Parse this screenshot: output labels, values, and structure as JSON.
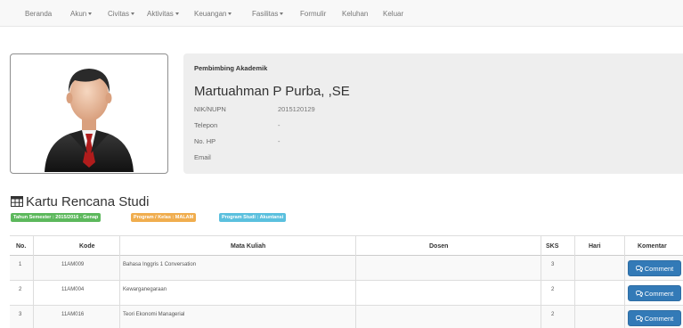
{
  "nav": {
    "items": [
      {
        "label": "Beranda",
        "dropdown": false
      },
      {
        "label": "Akun",
        "dropdown": true
      },
      {
        "label": "Civitas",
        "dropdown": true
      },
      {
        "label": "Aktivitas",
        "dropdown": true
      },
      {
        "label": "Keuangan",
        "dropdown": true
      },
      {
        "label": "Fasilitas",
        "dropdown": true
      },
      {
        "label": "Formulir",
        "dropdown": false
      },
      {
        "label": "Keluhan",
        "dropdown": false
      },
      {
        "label": "Keluar",
        "dropdown": false
      }
    ]
  },
  "profile": {
    "heading": "Pembimbing Akademik",
    "name": "Martuahman P Purba, ,SE",
    "fields": [
      {
        "label": "NIK/NUPN",
        "value": "2015120129"
      },
      {
        "label": "Telepon",
        "value": "-"
      },
      {
        "label": "No. HP",
        "value": "-"
      },
      {
        "label": "Email",
        "value": ""
      }
    ]
  },
  "krs": {
    "title": "Kartu Rencana Studi",
    "title_icon": "table-icon",
    "labels": [
      {
        "text": "Tahun Semester : 2015/2016 - Genap",
        "color": "#5cb85c"
      },
      {
        "text": "Program / Kelas : MALAM",
        "color": "#f0ad4e"
      },
      {
        "text": "Program Studi : Akuntansi",
        "color": "#5bc0de"
      }
    ]
  },
  "table": {
    "headers": [
      "No.",
      "Kode",
      "Mata Kuliah",
      "Dosen",
      "SKS",
      "Hari",
      "Komentar"
    ],
    "rows": [
      {
        "no": "1",
        "kode": "11AM009",
        "mk": "Bahasa Inggris 1 Conversation",
        "dosen": "",
        "sks": "3",
        "hari": ""
      },
      {
        "no": "2",
        "kode": "11AM004",
        "mk": "Kewarganegaraan",
        "dosen": "",
        "sks": "2",
        "hari": ""
      },
      {
        "no": "3",
        "kode": "11AM016",
        "mk": "Teori Ekonomi Managerial",
        "dosen": "",
        "sks": "2",
        "hari": ""
      }
    ],
    "comment_label": "Comment",
    "comment_icon": "comments-icon"
  },
  "colors": {
    "primary": "#337ab7",
    "navbar_bg": "#f8f8f8",
    "panel_bg": "#eeeeee"
  }
}
